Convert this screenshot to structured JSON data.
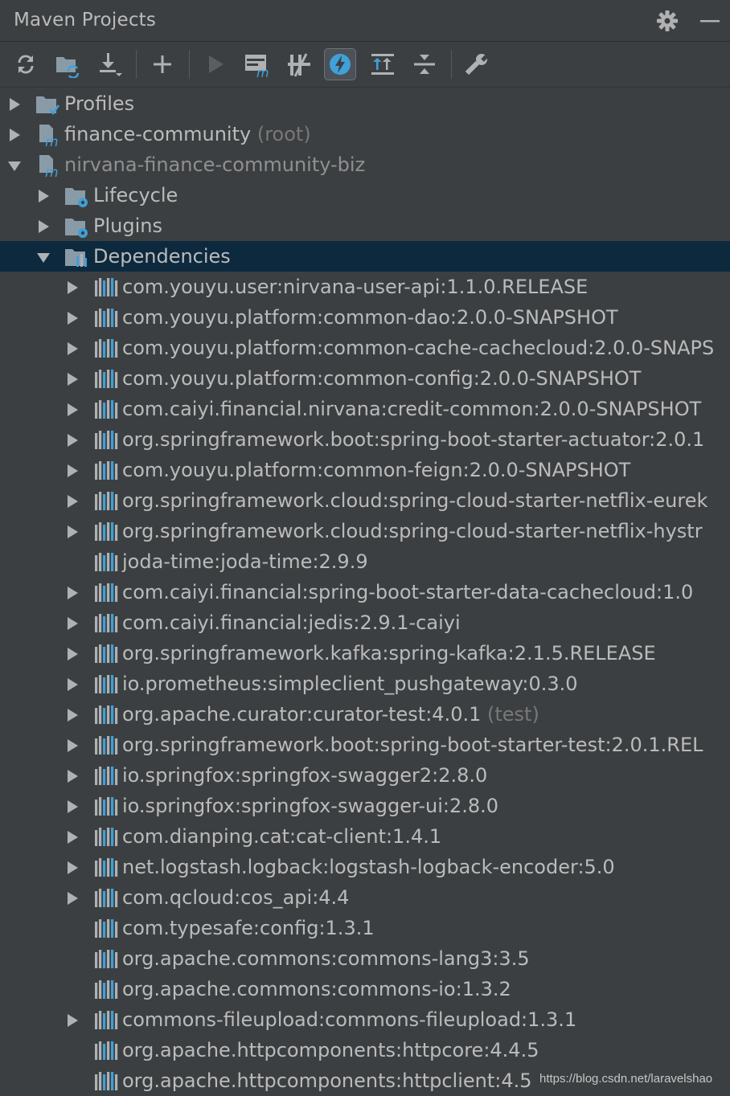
{
  "panel": {
    "title": "Maven Projects"
  },
  "toolbar": {
    "buttons": [
      {
        "name": "reimport-all-icon"
      },
      {
        "name": "generate-sources-icon"
      },
      {
        "name": "download-sources-icon"
      },
      {
        "name": "add-maven-project-icon"
      },
      {
        "name": "run-maven-build-icon"
      },
      {
        "name": "execute-maven-goal-icon"
      },
      {
        "name": "toggle-offline-mode-icon"
      },
      {
        "name": "toggle-skip-tests-icon",
        "active": true
      },
      {
        "name": "show-dependencies-icon"
      },
      {
        "name": "collapse-all-icon"
      },
      {
        "name": "maven-settings-icon"
      }
    ]
  },
  "tree": {
    "root_items": [
      {
        "label": "Profiles",
        "expanded": false,
        "icon": "profiles-folder-icon"
      },
      {
        "label": "finance-community",
        "suffix": " (root)",
        "expanded": false,
        "icon": "maven-module-icon"
      },
      {
        "label": "nirvana-finance-community-biz",
        "expanded": true,
        "icon": "maven-module-icon"
      }
    ],
    "module_children": [
      {
        "label": "Lifecycle",
        "expanded": false,
        "icon": "lifecycle-folder-icon"
      },
      {
        "label": "Plugins",
        "expanded": false,
        "icon": "plugins-folder-icon"
      },
      {
        "label": "Dependencies",
        "expanded": true,
        "selected": true,
        "icon": "dependencies-folder-icon"
      }
    ],
    "dependencies": [
      {
        "label": "com.youyu.user:nirvana-user-api:1.1.0.RELEASE",
        "has_children": true
      },
      {
        "label": "com.youyu.platform:common-dao:2.0.0-SNAPSHOT",
        "has_children": true
      },
      {
        "label": "com.youyu.platform:common-cache-cachecloud:2.0.0-SNAPS",
        "has_children": true
      },
      {
        "label": "com.youyu.platform:common-config:2.0.0-SNAPSHOT",
        "has_children": true
      },
      {
        "label": "com.caiyi.financial.nirvana:credit-common:2.0.0-SNAPSHOT",
        "has_children": true
      },
      {
        "label": "org.springframework.boot:spring-boot-starter-actuator:2.0.1",
        "has_children": true
      },
      {
        "label": "com.youyu.platform:common-feign:2.0.0-SNAPSHOT",
        "has_children": true
      },
      {
        "label": "org.springframework.cloud:spring-cloud-starter-netflix-eurek",
        "has_children": true
      },
      {
        "label": "org.springframework.cloud:spring-cloud-starter-netflix-hystr",
        "has_children": true
      },
      {
        "label": "joda-time:joda-time:2.9.9",
        "has_children": false
      },
      {
        "label": "com.caiyi.financial:spring-boot-starter-data-cachecloud:1.0",
        "has_children": true
      },
      {
        "label": "com.caiyi.financial:jedis:2.9.1-caiyi",
        "has_children": true
      },
      {
        "label": "org.springframework.kafka:spring-kafka:2.1.5.RELEASE",
        "has_children": true
      },
      {
        "label": "io.prometheus:simpleclient_pushgateway:0.3.0",
        "has_children": true
      },
      {
        "label": "org.apache.curator:curator-test:4.0.1",
        "suffix": " (test)",
        "has_children": true
      },
      {
        "label": "org.springframework.boot:spring-boot-starter-test:2.0.1.REL",
        "has_children": true
      },
      {
        "label": "io.springfox:springfox-swagger2:2.8.0",
        "has_children": true
      },
      {
        "label": "io.springfox:springfox-swagger-ui:2.8.0",
        "has_children": true
      },
      {
        "label": "com.dianping.cat:cat-client:1.4.1",
        "has_children": true
      },
      {
        "label": "net.logstash.logback:logstash-logback-encoder:5.0",
        "has_children": true
      },
      {
        "label": "com.qcloud:cos_api:4.4",
        "has_children": true
      },
      {
        "label": "com.typesafe:config:1.3.1",
        "has_children": false
      },
      {
        "label": "org.apache.commons:commons-lang3:3.5",
        "has_children": false
      },
      {
        "label": "org.apache.commons:commons-io:1.3.2",
        "has_children": false
      },
      {
        "label": "commons-fileupload:commons-fileupload:1.3.1",
        "has_children": true
      },
      {
        "label": "org.apache.httpcomponents:httpcore:4.4.5",
        "has_children": false
      },
      {
        "label": "org.apache.httpcomponents:httpclient:4.5",
        "has_children": false
      }
    ]
  },
  "watermark": "https://blog.csdn.net/laravelshao",
  "colors": {
    "background": "#3c3f41",
    "selection": "#0d293e",
    "text": "#bbbbbb",
    "dim_text": "#787878",
    "maven_blue": "#40a0d8",
    "folder": "#8a9ba8"
  }
}
